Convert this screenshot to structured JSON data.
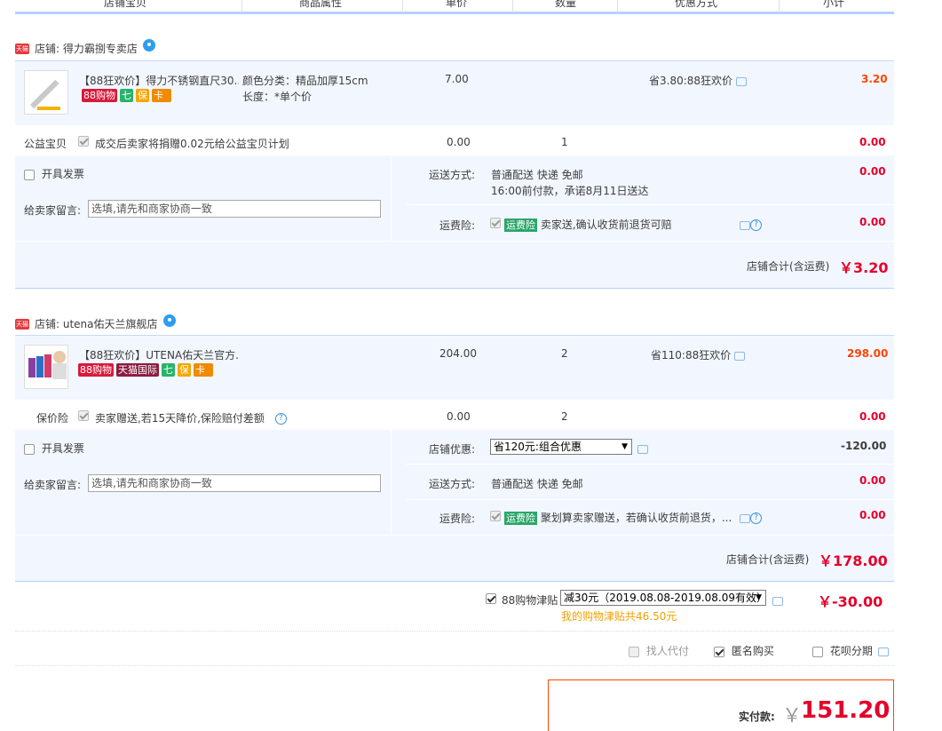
{
  "header": {
    "cols": [
      "店铺宝贝",
      "商品属性",
      "单价",
      "数量",
      "优惠方式",
      "小计"
    ]
  },
  "shops": [
    {
      "name": "店铺: 得力霸捌专卖店",
      "tmall_badge": "天猫",
      "product": {
        "title": "【88狂欢价】得力不锈钢直尺30...",
        "thumb_text": "得力直尺",
        "badges": [
          "88购物",
          "",
          "",
          "",
          ""
        ],
        "attr1": "颜色分类：精品加厚15cm",
        "attr2": "长度：*单个价",
        "price": "7.00",
        "qty": "",
        "discount": "省3.80:88狂欢价",
        "subtotal": "3.20"
      },
      "extra": {
        "label": "公益宝贝",
        "text": "成交后卖家将捐赠0.02元给公益宝贝计划",
        "price": "0.00",
        "qty": "1",
        "subtotal": "0.00"
      },
      "invoice": "开具发票",
      "message_label": "给卖家留言:",
      "message_placeholder": "选填,请先和商家协商一致",
      "shipping_label": "运送方式:",
      "shipping_line1": "普通配送 快递 免邮",
      "shipping_line2": "16:00前付款，承诺8月11日送达",
      "shipping_amount": "0.00",
      "ins_label": "运费险:",
      "ins_tag": "运费险",
      "ins_text": "卖家送,确认收货前退货可赔",
      "ins_amount": "0.00",
      "total_label": "店铺合计(含运费)",
      "total": "￥3.20"
    },
    {
      "name": "店铺: utena佑天兰旗舰店",
      "tmall_badge": "天猫",
      "product": {
        "title": "【88狂欢价】UTENA佑天兰官方...",
        "badges": [
          "88购物",
          "天猫国际"
        ],
        "price": "204.00",
        "qty": "2",
        "discount": "省110:88狂欢价",
        "subtotal": "298.00"
      },
      "extra": {
        "label": "保价险",
        "text": "卖家赠送,若15天降价,保险赔付差额",
        "price": "0.00",
        "qty": "2",
        "subtotal": "0.00"
      },
      "invoice": "开具发票",
      "message_label": "给卖家留言:",
      "message_placeholder": "选填,请先和商家协商一致",
      "coupon_label": "店铺优惠:",
      "coupon_value": "省120元:组合优惠",
      "coupon_amount": "-120.00",
      "shipping_label": "运送方式:",
      "shipping_line1": "普通配送 快递 免邮",
      "shipping_amount": "0.00",
      "ins_label": "运费险:",
      "ins_tag": "运费险",
      "ins_text": "聚划算卖家赠送，若确认收货前退货，...",
      "ins_amount": "0.00",
      "total_label": "店铺合计(含运费)",
      "total": "￥178.00"
    }
  ],
  "allowance": {
    "label": "88购物津贴",
    "select": "减30元（2019.08.08-2019.08.09有效）",
    "note": "我的购物津贴共46.50元",
    "amount": "￥-30.00"
  },
  "options": {
    "proxy": "找人代付",
    "anon": "匿名购买",
    "huabei": "花呗分期"
  },
  "payment": {
    "label": "实付款:",
    "currency": "￥",
    "amount": "151.20"
  },
  "colors": {
    "accent": "#ff4400",
    "header_border": "#b2d1ff",
    "row_bg": "#f2f7ff"
  }
}
